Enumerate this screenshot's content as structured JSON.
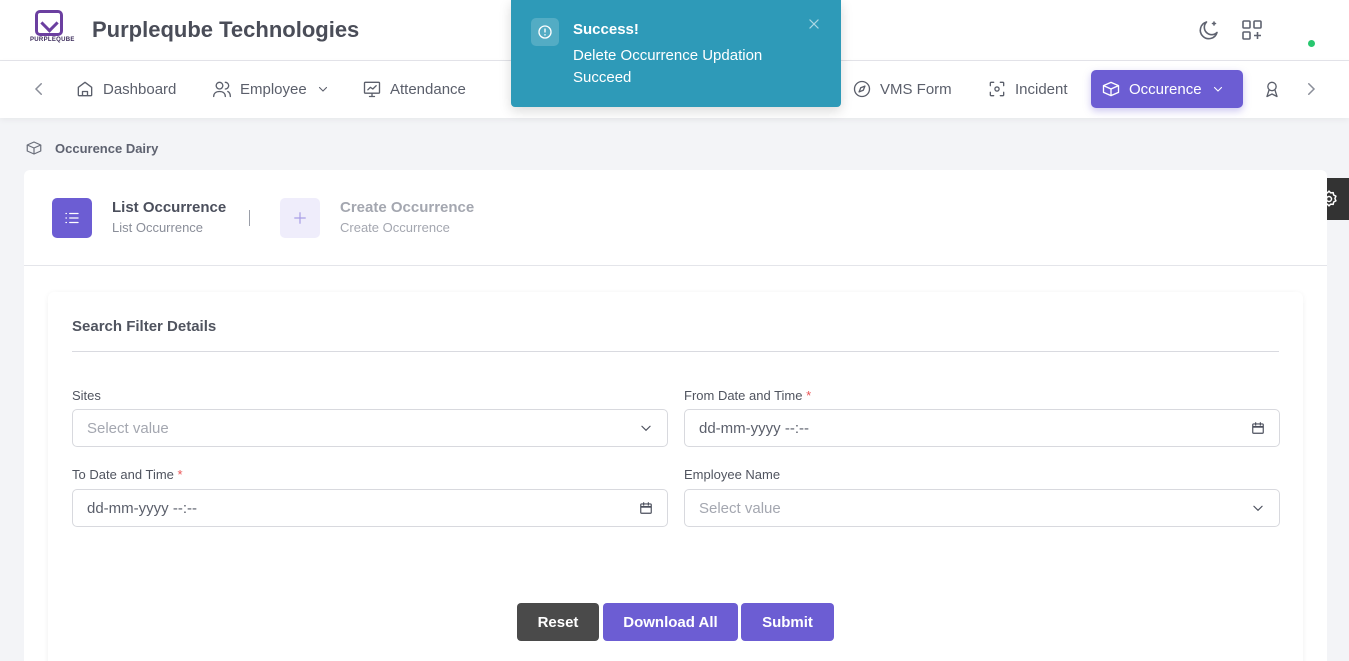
{
  "header": {
    "logo_text": "PURPLEQUBE",
    "company_name": "Purpleqube Technologies",
    "icons": [
      "theme-moon-icon",
      "apps-grid-icon"
    ]
  },
  "nav": {
    "items": [
      {
        "label": "Dashboard",
        "icon": "home-icon"
      },
      {
        "label": "Employee",
        "icon": "users-icon",
        "dropdown": true
      },
      {
        "label": "Attendance",
        "icon": "monitor-chart-icon"
      },
      {
        "label": "VMS Form",
        "icon": "compass-icon"
      },
      {
        "label": "Incident",
        "icon": "scan-icon"
      },
      {
        "label": "Occurence",
        "icon": "boxes-icon",
        "dropdown": true,
        "active": true
      }
    ],
    "active_color": "#6c5dd3"
  },
  "toast": {
    "title": "Success!",
    "message": "Delete Occurrence Updation Succeed",
    "color": "#2e9ab8"
  },
  "breadcrumb": {
    "label": "Occurence Dairy"
  },
  "steps": {
    "list": {
      "title": "List Occurrence",
      "subtitle": "List Occurrence"
    },
    "create": {
      "title": "Create Occurrence",
      "subtitle": "Create Occurrence"
    }
  },
  "filter": {
    "title": "Search Filter Details",
    "sites": {
      "label": "Sites",
      "placeholder": "Select value"
    },
    "from_date": {
      "label": "From Date and Time",
      "required": "*",
      "value": "dd-mm-yyyy --:--"
    },
    "to_date": {
      "label": "To Date and Time",
      "required": "*",
      "value": "dd-mm-yyyy --:--"
    },
    "employee": {
      "label": "Employee Name",
      "placeholder": "Select value"
    }
  },
  "buttons": {
    "reset": "Reset",
    "download_all": "Download All",
    "submit": "Submit"
  }
}
